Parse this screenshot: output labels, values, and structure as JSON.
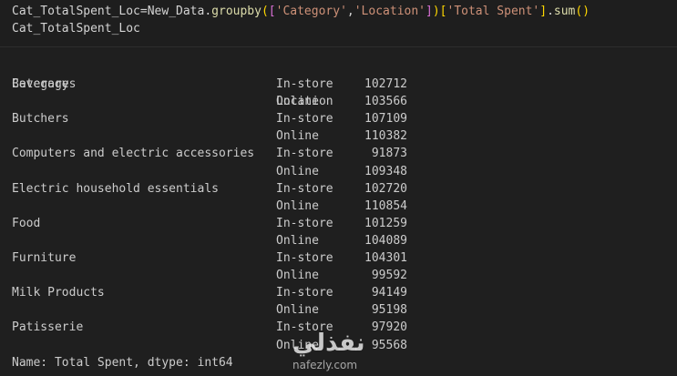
{
  "code": {
    "line1": {
      "var": "Cat_TotalSpent_Loc",
      "op": "=",
      "obj": "New_Data.",
      "fn": "groupby",
      "open1": "(",
      "open2": "[",
      "str1": "'Category'",
      "comma": ",",
      "str2": "'Location'",
      "close2": "]",
      "close1": ")",
      "open3": "[",
      "str3": "'Total Spent'",
      "close3": "]",
      "dot": ".",
      "fn2": "sum",
      "parens": "()"
    },
    "line2": "Cat_TotalSpent_Loc"
  },
  "output": {
    "header": {
      "category": "Category",
      "location": "Location"
    },
    "rows": [
      {
        "category": "Beverages",
        "location": "In-store",
        "value": "102712"
      },
      {
        "category": "",
        "location": "Online",
        "value": "103566"
      },
      {
        "category": "Butchers",
        "location": "In-store",
        "value": "107109"
      },
      {
        "category": "",
        "location": "Online",
        "value": "110382"
      },
      {
        "category": "Computers and electric accessories",
        "location": "In-store",
        "value": "91873"
      },
      {
        "category": "",
        "location": "Online",
        "value": "109348"
      },
      {
        "category": "Electric household essentials",
        "location": "In-store",
        "value": "102720"
      },
      {
        "category": "",
        "location": "Online",
        "value": "110854"
      },
      {
        "category": "Food",
        "location": "In-store",
        "value": "101259"
      },
      {
        "category": "",
        "location": "Online",
        "value": "104089"
      },
      {
        "category": "Furniture",
        "location": "In-store",
        "value": "104301"
      },
      {
        "category": "",
        "location": "Online",
        "value": "99592"
      },
      {
        "category": "Milk Products",
        "location": "In-store",
        "value": "94149"
      },
      {
        "category": "",
        "location": "Online",
        "value": "95198"
      },
      {
        "category": "Patisserie",
        "location": "In-store",
        "value": "97920"
      },
      {
        "category": "",
        "location": "Online",
        "value": "95568"
      }
    ],
    "footer": "Name: Total Spent, dtype: int64"
  },
  "watermark": {
    "arabic": "نفذلي",
    "latin": "nafezly.com"
  }
}
